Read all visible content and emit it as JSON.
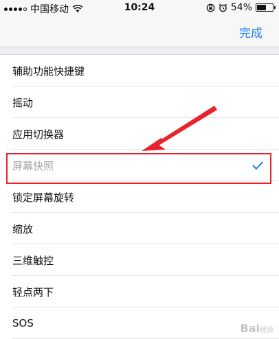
{
  "status_bar": {
    "carrier": "中国移动",
    "time": "10:24",
    "battery_percent": "54%",
    "battery_level": 0.54,
    "icons": [
      "signal-icon",
      "wifi-icon",
      "rotation-lock-icon",
      "alarm-icon",
      "battery-icon"
    ]
  },
  "nav": {
    "done_label": "完成"
  },
  "list": {
    "items": [
      {
        "label": "辅助功能快捷键"
      },
      {
        "label": "摇动"
      },
      {
        "label": "应用切换器"
      },
      {
        "label": "屏幕快照",
        "selected": true
      },
      {
        "label": "锁定屏幕旋转"
      },
      {
        "label": "缩放"
      },
      {
        "label": "三维触控"
      },
      {
        "label": "轻点两下"
      },
      {
        "label": "SOS"
      }
    ]
  },
  "watermark": {
    "brand": "Bai",
    "brand_suffix": "经验"
  },
  "colors": {
    "accent": "#1a7cf5",
    "highlight": "#e8232b",
    "selected_text": "#a4a4a8"
  }
}
